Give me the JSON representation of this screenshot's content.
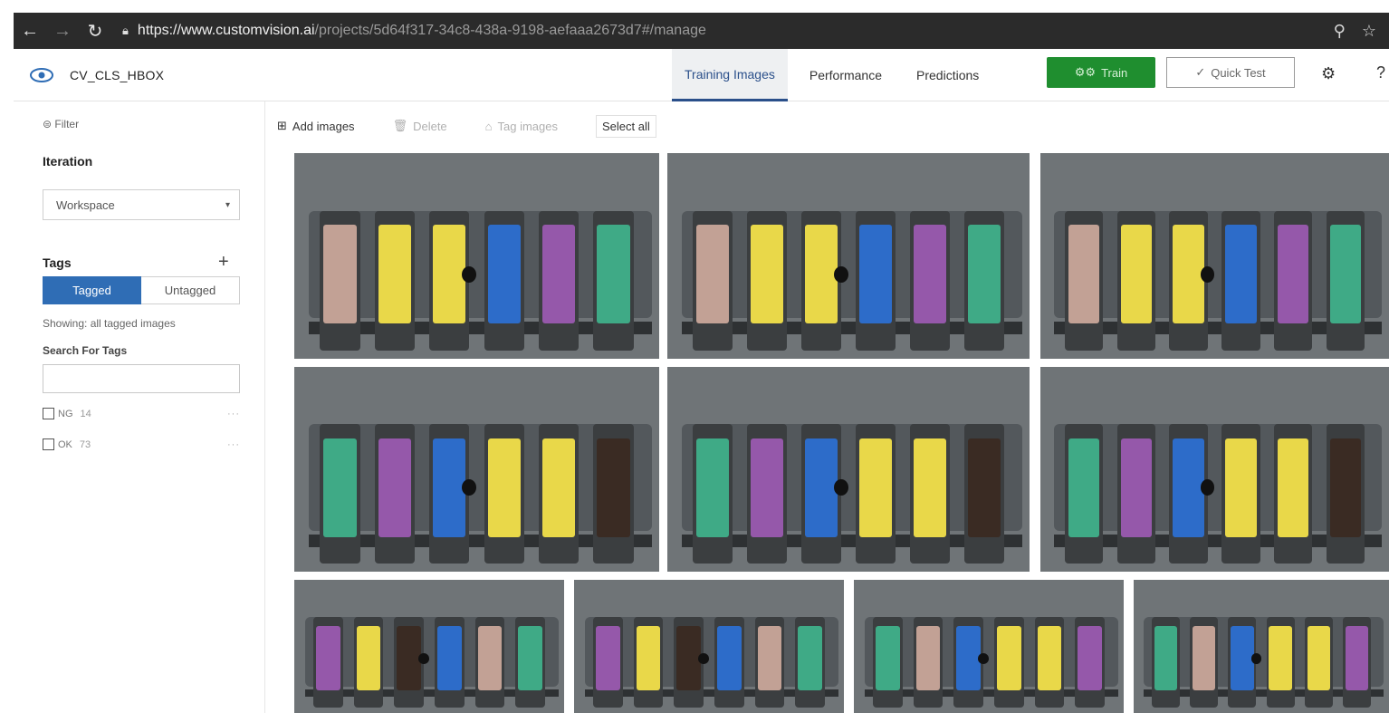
{
  "browser": {
    "url_host": "https://www.customvision.ai",
    "url_path": "/projects/5d64f317-34c8-438a-9198-aefaaa2673d7#/manage"
  },
  "header": {
    "project_name": "CV_CLS_HBOX",
    "tabs": [
      "Training Images",
      "Performance",
      "Predictions"
    ],
    "active_tab": "Training Images",
    "train_label": "Train",
    "quick_test_label": "Quick Test"
  },
  "sidebar": {
    "filter_label": "Filter",
    "iteration_title": "Iteration",
    "iteration_value": "Workspace",
    "tags_title": "Tags",
    "tagged_label": "Tagged",
    "untagged_label": "Untagged",
    "showing_text": "Showing: all tagged images",
    "search_label": "Search For Tags",
    "search_value": "",
    "tags": [
      {
        "name": "NG",
        "count": "14"
      },
      {
        "name": "OK",
        "count": "73"
      }
    ]
  },
  "toolbar": {
    "add_images": "Add images",
    "delete": "Delete",
    "tag_images": "Tag images",
    "select_all": "Select all"
  },
  "colors": {
    "accent_blue": "#2f6db5",
    "train_green": "#1f8e2f",
    "fuse_pink": "#c9a79a",
    "fuse_yellow": "#f2e04a",
    "fuse_blue": "#2c6fd1",
    "fuse_purple": "#9a5ab0",
    "fuse_green": "#3fb08a",
    "fuse_black": "#3a2a22"
  },
  "icons": {
    "back": "arrow-left-icon",
    "forward": "arrow-right-icon",
    "reload": "reload-icon",
    "lock": "lock-icon",
    "zoom": "zoom-icon",
    "star": "star-icon",
    "logo": "eye-icon",
    "settings": "gear-icon",
    "help": "help-icon",
    "filter": "filter-icon",
    "add": "add-images-icon",
    "delete": "trash-icon",
    "tag": "tag-icon"
  }
}
